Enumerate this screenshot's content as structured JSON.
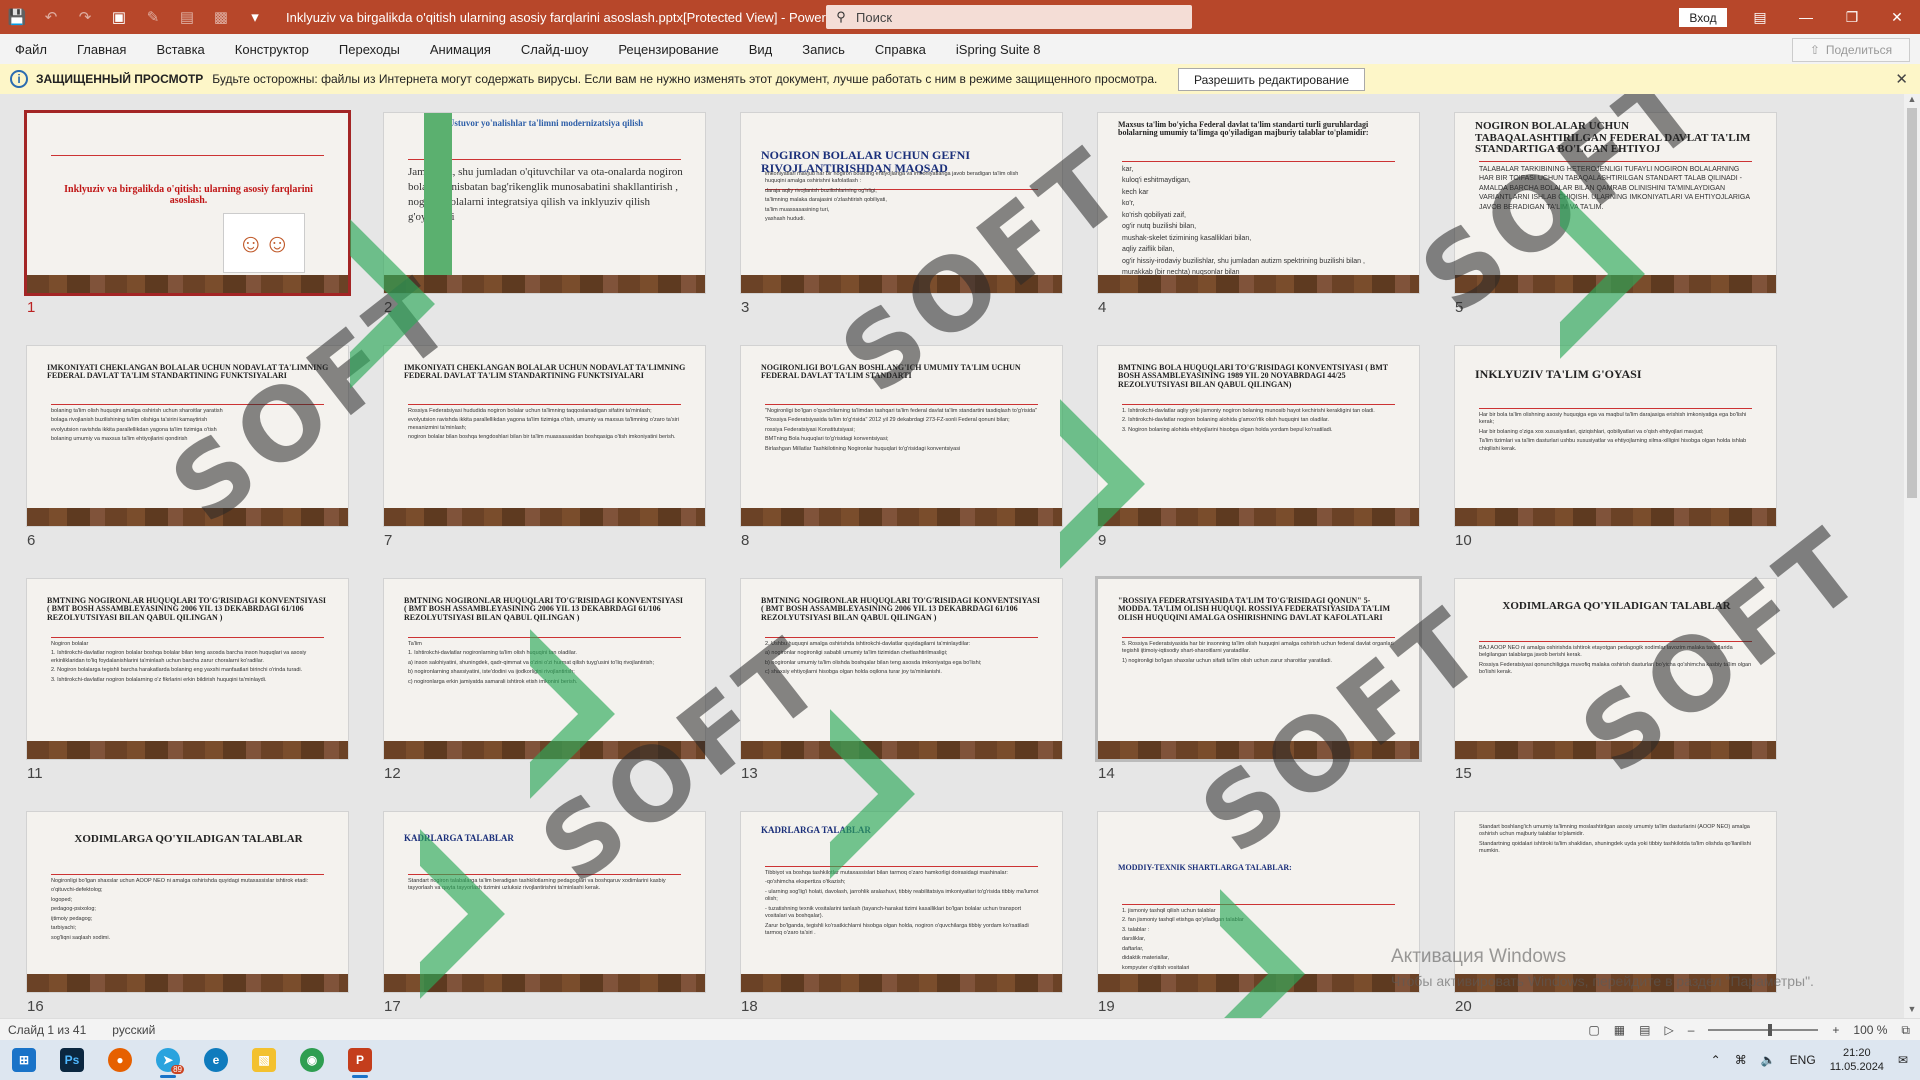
{
  "app": {
    "title": "Inklyuziv va birgalikda o'qitish ularning asosiy farqlarini asoslash.pptx[Protected View]  -  PowerPoint",
    "search_placeholder": "Поиск",
    "login_label": "Вход",
    "accent_color": "#b7472a"
  },
  "menu": {
    "items": [
      "Файл",
      "Главная",
      "Вставка",
      "Конструктор",
      "Переходы",
      "Анимация",
      "Слайд-шоу",
      "Рецензирование",
      "Вид",
      "Запись",
      "Справка",
      "iSpring Suite 8"
    ],
    "share_label": "Поделиться"
  },
  "protected_view": {
    "title": "ЗАЩИЩЕННЫЙ ПРОСМОТР",
    "message": "Будьте осторожны: файлы из Интернета могут содержать вирусы. Если вам не нужно изменять этот документ, лучше работать с ним в режиме защищенного просмотра.",
    "button_label": "Разрешить редактирование"
  },
  "slides": [
    {
      "num": "1",
      "title": "Inklyuziv va birgalikda o'qitish: ularning asosiy farqlarini asoslash.",
      "body": []
    },
    {
      "num": "2",
      "title": "Ustuvor yo'nalishlar ta'limni modernizatsiya qilish",
      "body": [
        "Jamiyatda, shu jumladan o'qituvchilar va ota-onalarda nogiron bolalarga nisbatan bag'rikenglik munosabatini shakllantirish , nogiron bolalarni integratsiya qilish va inklyuziv qilish g'oyalarini"
      ]
    },
    {
      "num": "3",
      "title": "NOGIRON BOLALAR UCHUN GEFNI RIVOJLANTIRISHDAN MAQSAD",
      "body": [
        "imkoniyatlari mavjud har bir nogiron bolaning ehtiyojlariga va imkoniyatlariga javob beradigan ta'lim olish huquqini amalga oshirishni kafolatlash :",
        "darajа aqliy rivojlanish buzilishlarining og'irligi,",
        "ta'limning malaka darajasini o'zlashtirish qobiliyati,",
        "ta'lim muassasasining turi,",
        "yashash hududi."
      ]
    },
    {
      "num": "4",
      "title": "Maxsus ta'lim bo'yicha Federal davlat ta'lim standarti turli guruhlardagi bolalarning umumiy ta'limga qo'yiladigan majburiy talablar to'plamidir:",
      "body": [
        "kar,",
        "kuloq'i eshitmaydigan,",
        "kech kar",
        "ko'r,",
        "ko'rish qobiliyati zaif,",
        "og'ir nutq buzilishi bilan,",
        "mushak-skelet tizimining kasalliklari bilan,",
        "aqliy zaiflik bilan,",
        "og'ir hissiy-irodaviy buzilishlar, shu jumladan autizm spektrining buzilishi bilan ,",
        "murakkab (bir nechta) nuqsonlar bilan"
      ]
    },
    {
      "num": "5",
      "title": "NOGIRON BOLALAR UCHUN TABAQALASHTIRILGAN FEDERAL DAVLAT TA'LIM STANDARTIGA BO'LGAN EHTIYOJ",
      "body": [
        "TALABALAR TARKIBINING HETEROJENLIGI TUFAYLI NOGIRON BOLALARNING HAR BIR TOIFASI UCHUN TABAQALASHTIRILGAN STANDART TALAB QILINADI - AMALDA BARCHA BOLALAR BILAN QAMRAB OLINISHINI TA'MINLAYDIGAN VARIANTLARNI ISHLAB CHIQISH. ULARNING IMKONIYATLARI VA EHTIYOJLARIGA JAVOB BERADIGAN TA'LIM VA TA'LIM."
      ]
    },
    {
      "num": "6",
      "title": "IMKONIYATI CHEKLANGAN BOLALAR UCHUN NODAVLAT TA'LIMNING FEDERAL DAVLAT TA'LIM STANDARTINING FUNKTSIYALARI",
      "body": [
        "bolaning ta'lim olish huquqini amalga oshirish uchun sharoitlar yaratish",
        "bolaga rivojlanish buzilishining ta'lim olishiga ta'sirini kamaytirish",
        "evolyutsion ravishda ikkita parallellikdan yagona ta'lim tizimiga o'tish",
        "bolaning umumiy va maxsus ta'lim ehtiyojlarini qondirish"
      ]
    },
    {
      "num": "7",
      "title": "IMKONIYATI CHEKLANGAN BOLALAR UCHUN NODAVLAT TA'LIMNING FEDERAL DAVLAT TA'LIM STANDARTINING FUNKTSIYALARI",
      "body": [
        "Rossiya Federatsiyasi hududida nogiron bolalar uchun ta'limning taqqoslanadigan sifatini ta'minlash;",
        "evolyutsion ravishda ikkita parallellikdan yagona ta'lim tizimiga o'tish, umumiy va maxsus ta'limning o'zaro ta'siri mexanizmini ta'minlash;",
        "nogiron bolalar bilan boshqa tengdoshlari bilan bir ta'lim muassasasidan boshqasiga o'tish imkoniyatini berish."
      ]
    },
    {
      "num": "8",
      "title": "NOGIRONLIGI BO'LGAN BOSHLANG'ICH UMUMIY TA'LIM UCHUN FEDERAL DAVLAT TA'LIM STANDARTI",
      "body": [
        "\"Nogironligi bo'lgan o'quvchilarning ta'limdan tashqari ta'lim federal davlat ta'lim standartini tasdiqlash to'g'risida\"",
        "\"Rossiya Federatsiyasida ta'lim to'g'risida\" 2012 yil 29 dekabrdagi 273-FZ-sonli Federal qonuni bilan;",
        "rossiya Federatsiyasi Konstitutsiyasi;",
        "BMTning Bola huquqlari to'g'risidagi konventsiyasi;",
        "Birlashgan Millatlar Tashkilotining Nogironlar huquqlari to'g'risidagi konventsiyasi"
      ]
    },
    {
      "num": "9",
      "title": "BMTNING BOLA HUQUQLARI TO'G'RISIDAGI KONVENTSIYASI ( BMT BOSH ASSAMBLEYASINING 1989 YIL 20 NOYABRDAGI 44/25 REZOLYUTSIYASI BILAN QABUL QILINGAN)",
      "body": [
        "1. Ishtirokchi-davlatlar aqliy yoki jismoniy nogiron bolaning munosib hayot kechirishi kerakligini tan oladi.",
        "2. Ishtirokchi-davlatlar nogiron bolaning alohida g'amxo'rlik olish huquqini tan oladilar.",
        "3. Nogiron bolaning alohida ehtiyojlarini hisobga olgan holda yordam bepul ko'rsatiladi."
      ]
    },
    {
      "num": "10",
      "title": "INKLYUZIV TA'LIM G'OYASI",
      "body": [
        "Har bir bola ta'lim olishning asosiy huquqiga ega va maqbul ta'lim darajasiga erishish imkoniyatiga ega bo'lishi kerak;",
        "Har bir bolaning o'ziga xos xususiyatlari, qiziqishlari, qobiliyatlari va o'qish ehtiyojlari mavjud;",
        "Ta'lim tizimlari va ta'lim dasturlari ushbu xususiyatlar va ehtiyojlarning xilma-xilligini hisobga olgan holda ishlab chiqilishi kerak."
      ]
    },
    {
      "num": "11",
      "title": "BMTNING NOGIRONLAR HUQUQLARI TO'G'RISIDAGI KONVENTSIYASI ( BMT BOSH ASSAMBLEYASINING 2006 YIL 13 DEKABRDAGI 61/106 REZOLYUTSIYASI BILAN QABUL QILINGAN )",
      "body": [
        "Nogiron bolalar",
        "1. Ishtirokchi-davlatlar nogiron bolalar boshqa bolalar bilan teng asosda barcha inson huquqlari va asosiy erkinliklaridan to'liq foydalanishlarini ta'minlash uchun barcha zarur choralarni ko'radilar.",
        "2. Nogiron bolalarga tegishli barcha harakatlarda bolaning eng yaxshi manfaatlari birinchi o'rinda turadi.",
        "3. Ishtirokchi-davlatlar nogiron bolalarning o'z fikrlarini erkin bildirish huquqini ta'minlaydi."
      ]
    },
    {
      "num": "12",
      "title": "BMTNING NOGIRONLAR HUQUQLARI TO'G'RISIDAGI KONVENTSIYASI ( BMT BOSH ASSAMBLEYASINING 2006 YIL 13 DEKABRDAGI 61/106 REZOLYUTSIYASI BILAN QABUL QILINGAN )",
      "body": [
        "Ta'lim",
        "1. Ishtirokchi-davlatlar nogironlarning ta'lim olish huquqini tan oladilar.",
        "a) inson salohiyatini, shuningdek, qadr-qimmat va o'zini o'zi hurmat qilish tuyg'usini to'liq rivojlantirish;",
        "b) nogironlarning shaxsiyatini, iste'dodini va ijodkorligini rivojlantirish;",
        "c) nogironlarga erkin jamiyatda samarali ishtirok etish imkonini berish."
      ]
    },
    {
      "num": "13",
      "title": "BMTNING NOGIRONLAR HUQUQLARI TO'G'RISIDAGI KONVENTSIYASI ( BMT BOSH ASSAMBLEYASINING 2006 YIL 13 DEKABRDAGI 61/106 REZOLYUTSIYASI BILAN QABUL QILINGAN )",
      "body": [
        "2. Ushbu huquqni amalga oshirishda ishtirokchi-davlatlar quyidagilarni ta'minlaydilar:",
        "a) nogironlar nogironligi sababli umumiy ta'lim tizimidan chetlashtirilmasligi;",
        "b) nogironlar umumiy ta'lim olishda boshqalar bilan teng asosda imkoniyatga ega bo'lishi;",
        "c) shaxsiy ehtiyojlarni hisobga olgan holda oqilona turar joy ta'minlanishi."
      ]
    },
    {
      "num": "14",
      "title": "\"ROSSIYA FEDERATSIYASIDA TA'LIM TO'G'RISIDAGI QONUN\" 5-MODDA. TA'LIM OLISH HUQUQI. ROSSIYA FEDERATSIYASIDA TA'LIM OLISH HUQUQINI AMALGA OSHIRISHNING DAVLAT KAFOLATLARI",
      "body": [
        "5. Rossiya Federatsiyasida har bir insonning ta'lim olish huquqini amalga oshirish uchun federal davlat organlari tegishli ijtimoiy-iqtisodiy shart-sharoitlarni yaratadilar.",
        "1) nogironligi bo'lgan shaxslar uchun sifatli ta'lim olish uchun zarur sharoitlar yaratiladi."
      ]
    },
    {
      "num": "15",
      "title": "XODIMLARGA QO'YILADIGAN TALABLAR",
      "body": [
        "BAJ AOOP NEO ni amalga oshirishda ishtirok etayotgan pedagogik xodimlar lavozim malaka tavsiflarida belgilangan talablarga javob berishi kerak.",
        "Rossiya Federatsiyasi qonunchiligiga muvofiq malaka oshirish dasturlari bo'yicha qo'shimcha kasbiy ta'lim olgan bo'lishi kerak."
      ]
    },
    {
      "num": "16",
      "title": "XODIMLARGA QO'YILADIGAN TALABLAR",
      "body": [
        "Nogironligi bo'lgan shaxslar uchun AOOP NEO ni amalga oshirishda quyidagi mutaxassislar ishtirok etadi:",
        "o'qituvchi-defektolog;",
        "logoped;",
        "pedagog-psixolog;",
        "ijtimoiy pedagog;",
        "tarbiyachi;",
        "sog'liqni saqlash xodimi."
      ]
    },
    {
      "num": "17",
      "title": "KADRLARGA TALABLAR",
      "body": [
        "Standart nogiron talabalarga ta'lim beradigan tashkilotlarning pedagoglari va boshqaruv xodimlarini kasbiy tayyorlash va qayta tayyorlash tizimini uzluksiz rivojlantirishni ta'minlashi kerak."
      ]
    },
    {
      "num": "18",
      "title": "KADRLARGA TALABLAR",
      "body": [
        "Tibbiyot va boshqa tashkilotlar mutaxassislari bilan tarmoq o'zaro hamkorligi doirasidagi mashinalar:",
        "-qo'shimcha ekspertiza o'tkazish;",
        "- ularning sog'lig'i holati, davolash, jarrohlik aralashuvi, tibbiy reabilitatsiya imkoniyatlari to'g'risida tibbiy ma'lumot olish;",
        "- tuzatishning texnik vositalarini tanlash (tayanch-harakat tizimi kasalliklari bo'lgan bolalar uchun transport vositalari va boshqalar).",
        "Zarur bo'lganda, tegishli ko'rsatkichlarni hisobga olgan holda, nogiron o'quvchilarga tibbiy yordam ko'rsatiladi tarmoq o'zaro ta'siri ."
      ]
    },
    {
      "num": "19",
      "title": "MODDIY-TEXNIK SHARTLARGA TALABLAR:",
      "body": [
        "1. jismoniy tashqil qilish uchun talablar",
        "2. fan jismoniy tashqil etishga qo'yiladigan talablar",
        "3. talablar :",
        "darsliklar,",
        "daftarlar,",
        "didaktik materiallar,",
        "kompyuter o'qitish vositalari",
        "TALABALARNING MAXSUS TA'LIM EHTIYOJLARINI EGA BERISH"
      ]
    },
    {
      "num": "20",
      "title": "",
      "body": [
        "Standart boshlang'ich umumiy ta'limning moslashtirilgan asosiy umumiy ta'lim dasturlarini (AOOP NEO) amalga oshirish uchun majburiy talablar to'plamidir.",
        "Standartning qoidalari ishtiroki ta'lim shaklidan, shuningdek uyda yoki tibbiy tashkilotda ta'lim olishda qo'llanilishi mumkin."
      ]
    }
  ],
  "watermark": {
    "text": "SOFT"
  },
  "activate": {
    "title": "Активация Windows",
    "subtitle": "Чтобы активировать Windows, перейдите в раздел \"Параметры\"."
  },
  "status": {
    "slide_counter": "Слайд 1 из 41",
    "language": "русский",
    "zoom": "100 %"
  },
  "taskbar": {
    "apps": [
      "windows-start",
      "photoshop",
      "firefox",
      "telegram",
      "edge",
      "file-explorer",
      "chrome",
      "powerpoint"
    ],
    "telegram_badge": "89",
    "tray_lang": "ENG",
    "time": "21:20",
    "date": "11.05.2024"
  }
}
